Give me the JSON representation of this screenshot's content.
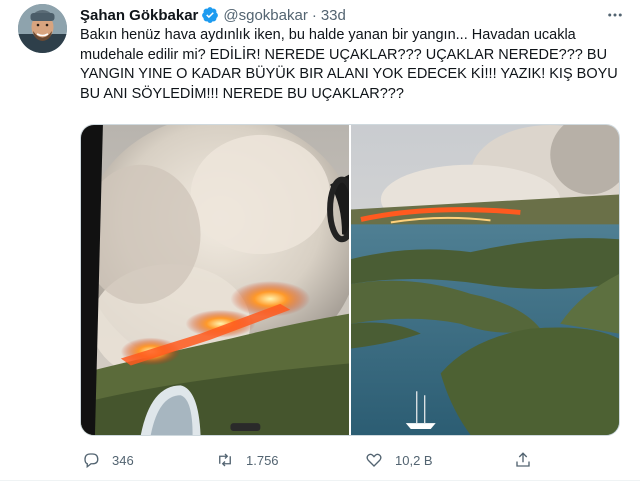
{
  "tweet": {
    "display_name": "Şahan Gökbakar",
    "handle": "@sgokbakar",
    "separator": "·",
    "time": "33d",
    "text": "Bakın henüz hava aydınlık iken, bu halde yanan bir yangın... Havadan ucakla mudehale edilir mi? EDİLİR! NEREDE UÇAKLAR??? UÇAKLAR NEREDE??? BU YANGIN YINE O KADAR BÜYÜK BIR ALANI YOK EDECEK Kİ!!! YAZIK! KIŞ BOYU BU ANI SÖYLEDİM!!! NEREDE BU UÇAKLAR???",
    "icons": {
      "verified": "verified-badge-icon",
      "more": "more-icon",
      "reply": "reply-icon",
      "retweet": "retweet-icon",
      "like": "heart-icon",
      "share": "share-icon"
    },
    "colors": {
      "verified": "#1d9bf0",
      "secondary_text": "#536471",
      "fire": "#ff5a1f"
    }
  },
  "actions": {
    "replies": "346",
    "retweets": "1.756",
    "likes": "10,2 B"
  }
}
